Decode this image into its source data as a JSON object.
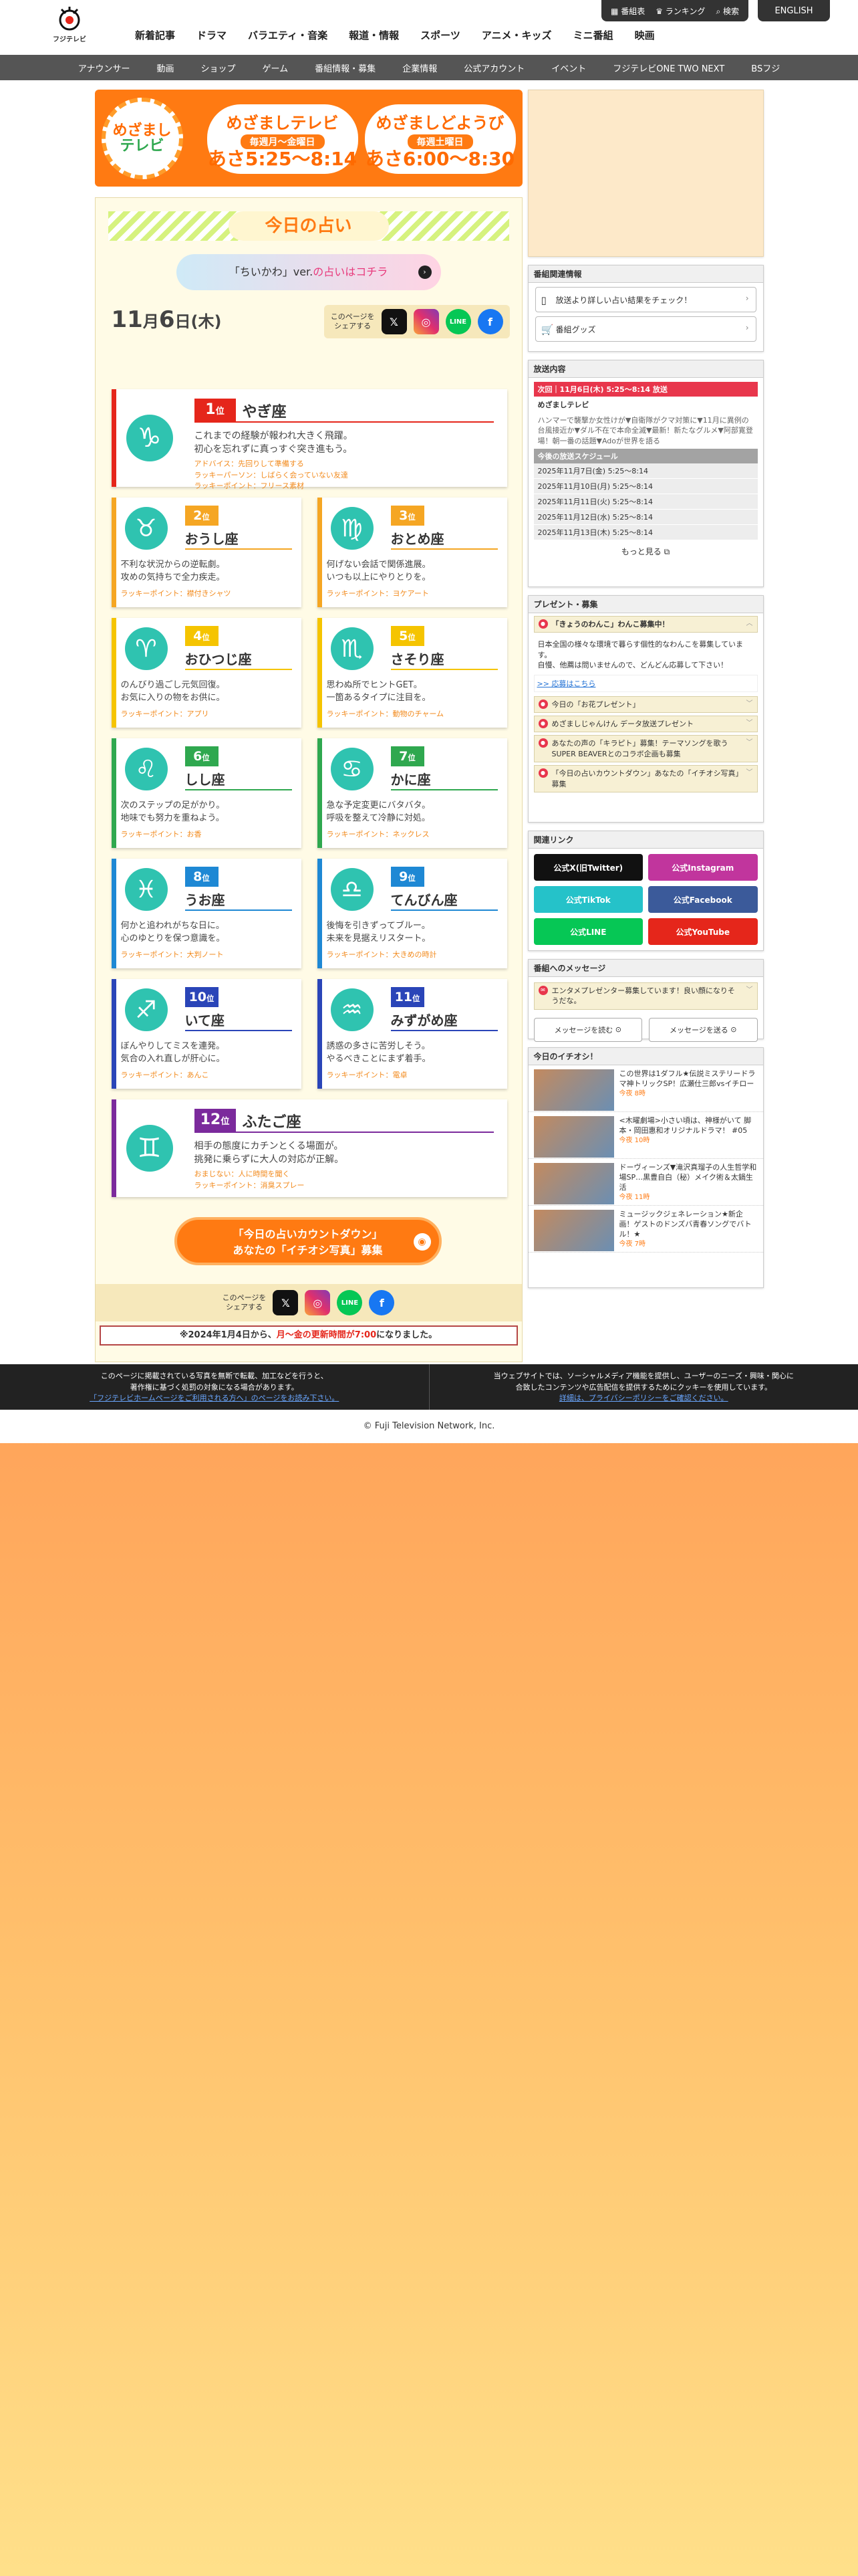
{
  "header": {
    "logo_text": "フジテレビ",
    "nav": [
      "新着記事",
      "ドラマ",
      "バラエティ・音楽",
      "報道・情報",
      "スポーツ",
      "アニメ・キッズ",
      "ミニ番組",
      "映画"
    ],
    "util": [
      "番組表",
      "ランキング",
      "検索"
    ],
    "english": "ENGLISH"
  },
  "subnav": [
    "アナウンサー",
    "動画",
    "ショップ",
    "ゲーム",
    "番組情報・募集",
    "企業情報",
    "公式アカウント",
    "イベント",
    "フジテレビONE TWO NEXT",
    "BSフジ"
  ],
  "banner": {
    "logo": [
      "めざまし",
      "テレビ"
    ],
    "card1": {
      "title": "めざましテレビ",
      "days": "毎週月〜金曜日",
      "time": "あさ5:25〜8:14"
    },
    "card2": {
      "title": "めざましどようび",
      "days": "毎週土曜日",
      "time": "あさ6:00〜8:30"
    }
  },
  "fortune": {
    "title": "今日の占い",
    "chiikawa": {
      "pre": "「ちいかわ」ver.",
      "link": "の占いはコチラ"
    },
    "date": {
      "month": "11",
      "month_unit": "月",
      "day": "6",
      "day_unit": "日",
      "weekday": "(木)"
    },
    "share_label": "このページを\nシェアする",
    "signs": [
      {
        "rank": "1",
        "rank_unit": "位",
        "name": "やぎ座",
        "desc": "これまでの経験が報われ大きく飛躍。\n初心を忘れずに真っすぐ突き進もう。",
        "advice": "アドバイス：先回りして準備する",
        "person": "ラッキーパーソン：しばらく会っていない友達",
        "point": "ラッキーポイント：フリース素材",
        "glyph": "♑",
        "color": "#e5261b"
      },
      {
        "rank": "2",
        "rank_unit": "位",
        "name": "おうし座",
        "desc": "不利な状況からの逆転劇。\n攻めの気持ちで全力疾走。",
        "point": "ラッキーポイント：襟付きシャツ",
        "glyph": "♉",
        "color": "#f5a623"
      },
      {
        "rank": "3",
        "rank_unit": "位",
        "name": "おとめ座",
        "desc": "何げない会話で関係進展。\nいつも以上にやりとりを。",
        "point": "ラッキーポイント：ヨケアート",
        "glyph": "♍",
        "color": "#f5a623"
      },
      {
        "rank": "4",
        "rank_unit": "位",
        "name": "おひつじ座",
        "desc": "のんびり過ごし元気回復。\nお気に入りの物をお供に。",
        "point": "ラッキーポイント：アプリ",
        "glyph": "♈",
        "color": "#f5c400"
      },
      {
        "rank": "5",
        "rank_unit": "位",
        "name": "さそり座",
        "desc": "思わぬ所でヒントGET。\n一箇あるタイプに注目を。",
        "point": "ラッキーポイント：動物のチャーム",
        "glyph": "♏",
        "color": "#f5c400"
      },
      {
        "rank": "6",
        "rank_unit": "位",
        "name": "しし座",
        "desc": "次のステップの足がかり。\n地味でも努力を重ねよう。",
        "point": "ラッキーポイント：お香",
        "glyph": "♌",
        "color": "#2fa84f"
      },
      {
        "rank": "7",
        "rank_unit": "位",
        "name": "かに座",
        "desc": "急な予定変更にバタバタ。\n呼吸を整えて冷静に対処。",
        "point": "ラッキーポイント：ネックレス",
        "glyph": "♋",
        "color": "#2fa84f"
      },
      {
        "rank": "8",
        "rank_unit": "位",
        "name": "うお座",
        "desc": "何かと追われがちな日に。\n心のゆとりを保つ意識を。",
        "point": "ラッキーポイント：大判ノート",
        "glyph": "♓",
        "color": "#1e88d4"
      },
      {
        "rank": "9",
        "rank_unit": "位",
        "name": "てんびん座",
        "desc": "後悔を引きずってブルー。\n未来を見据えリスタート。",
        "point": "ラッキーポイント：大きめの時計",
        "glyph": "♎",
        "color": "#1e88d4"
      },
      {
        "rank": "10",
        "rank_unit": "位",
        "name": "いて座",
        "desc": "ぼんやりしてミスを連発。\n気合の入れ直しが肝心に。",
        "point": "ラッキーポイント：あんこ",
        "glyph": "♐",
        "color": "#2a45b8"
      },
      {
        "rank": "11",
        "rank_unit": "位",
        "name": "みずがめ座",
        "desc": "誘惑の多さに苦労しそう。\nやるべきことにまず着手。",
        "point": "ラッキーポイント：電卓",
        "glyph": "♒",
        "color": "#2a45b8"
      },
      {
        "rank": "12",
        "rank_unit": "位",
        "name": "ふたご座",
        "desc": "相手の態度にカチンとくる場面が。\n挑発に乗らずに大人の対応が正解。",
        "advice": "おまじない：人に時間を聞く",
        "point": "ラッキーポイント：消臭スプレー",
        "glyph": "♊",
        "color": "#7b2a9c"
      }
    ],
    "countdown": [
      "「今日の占いカウントダウン」",
      "あなたの「イチオシ写真」募集"
    ],
    "notice": {
      "pre": "※2024年1月4日から、",
      "em": "月〜金の更新時間が7:00",
      "post": "になりました。"
    }
  },
  "sidebar": {
    "related_title": "番組関連情報",
    "related_buttons": [
      "放送より詳しい占い結果をチェック！",
      "番組グッズ"
    ],
    "broadcast_title": "放送内容",
    "next": "次回｜11月6日(木) 5:25〜8:14 放送",
    "show": "めざましテレビ",
    "body": "ハンマーで襲撃か女性けが▼自衛隊がクマ対策に▼11月に異例の台風接近か▼ダル不在で本命全滅▼最新！新たなグルメ▼阿部寛登場！朝一番の話題▼Adoが世界を語る",
    "schedule_title": "今後の放送スケジュール",
    "schedule": [
      "2025年11月7日(金) 5:25〜8:14",
      "2025年11月10日(月) 5:25〜8:14",
      "2025年11月11日(火) 5:25〜8:14",
      "2025年11月12日(水) 5:25〜8:14",
      "2025年11月13日(木) 5:25〜8:14"
    ],
    "more": "もっと見る",
    "present_title": "プレゼント・募集",
    "present_items": [
      {
        "title": "「きょうのわんこ」わんこ募集中！",
        "open": true,
        "body": "日本全国の様々な環境で暮らす個性的なわんこを募集しています。\n自慢、他薦は問いませんので、どんどん応募して下さい！",
        "link": ">> 応募はこちら"
      },
      {
        "title": "今日の「お花プレゼント」"
      },
      {
        "title": "めざましじゃんけん データ放送プレゼント"
      },
      {
        "title": "あなたの声の「キラピト」募集！テーマソングを歌うSUPER BEAVERとのコラボ企画も募集"
      },
      {
        "title": "「今日の占いカウントダウン」あなたの「イチオシ写真」募集"
      }
    ],
    "links_title": "関連リンク",
    "links": [
      {
        "label": "公式X(旧Twitter)",
        "color": "#111111"
      },
      {
        "label": "公式Instagram",
        "color": "#c1359d"
      },
      {
        "label": "公式TikTok",
        "color": "#25c2c9"
      },
      {
        "label": "公式Facebook",
        "color": "#3b5a9a"
      },
      {
        "label": "公式LINE",
        "color": "#06c755"
      },
      {
        "label": "公式YouTube",
        "color": "#e5261b"
      }
    ],
    "message_title": "番組へのメッセージ",
    "message_body": "エンタメプレゼンター募集しています！良い顔になりそうだな。",
    "message_buttons": [
      "メッセージを読む",
      "メッセージを送る"
    ],
    "ichioshi_title": "今日のイチオシ！",
    "ichioshi": [
      {
        "text": "この世界は1ダフル★伝説ミステリードラマ神トリックSP！広瀬仕三郎vsイチロー",
        "date": "今夜 8時"
      },
      {
        "text": "<木曜劇場>小さい頃は、神様がいて 脚本・岡田惠和オリジナルドラマ！ #05",
        "date": "今夜 10時"
      },
      {
        "text": "ドーヴィーンズ▼滝沢真瑠子の人生哲学和場SP…黒豊自白（秘）メイク術＆太鍋生活",
        "date": "今夜 11時"
      },
      {
        "text": "ミュージックジェネレーション★新企画！ゲストのドンズバ青春ソングでバトル！★",
        "date": "今夜 7時"
      }
    ]
  },
  "footer": {
    "left": [
      "このページに掲載されている写真を無断で転載、加工などを行うと、",
      "著作権に基づく処罰の対象になる場合があります。",
      "「フジテレビホームページをご利用される方へ」のページをお読み下さい。"
    ],
    "right": [
      "当ウェブサイトでは、ソーシャルメディア機能を提供し、ユーザーのニーズ・興味・関心に",
      "合致したコンテンツや広告配信を提供するためにクッキーを使用しています。",
      "詳細は、プライバシーポリシーをご確認ください。"
    ],
    "copyright": "© Fuji Television Network, Inc."
  }
}
